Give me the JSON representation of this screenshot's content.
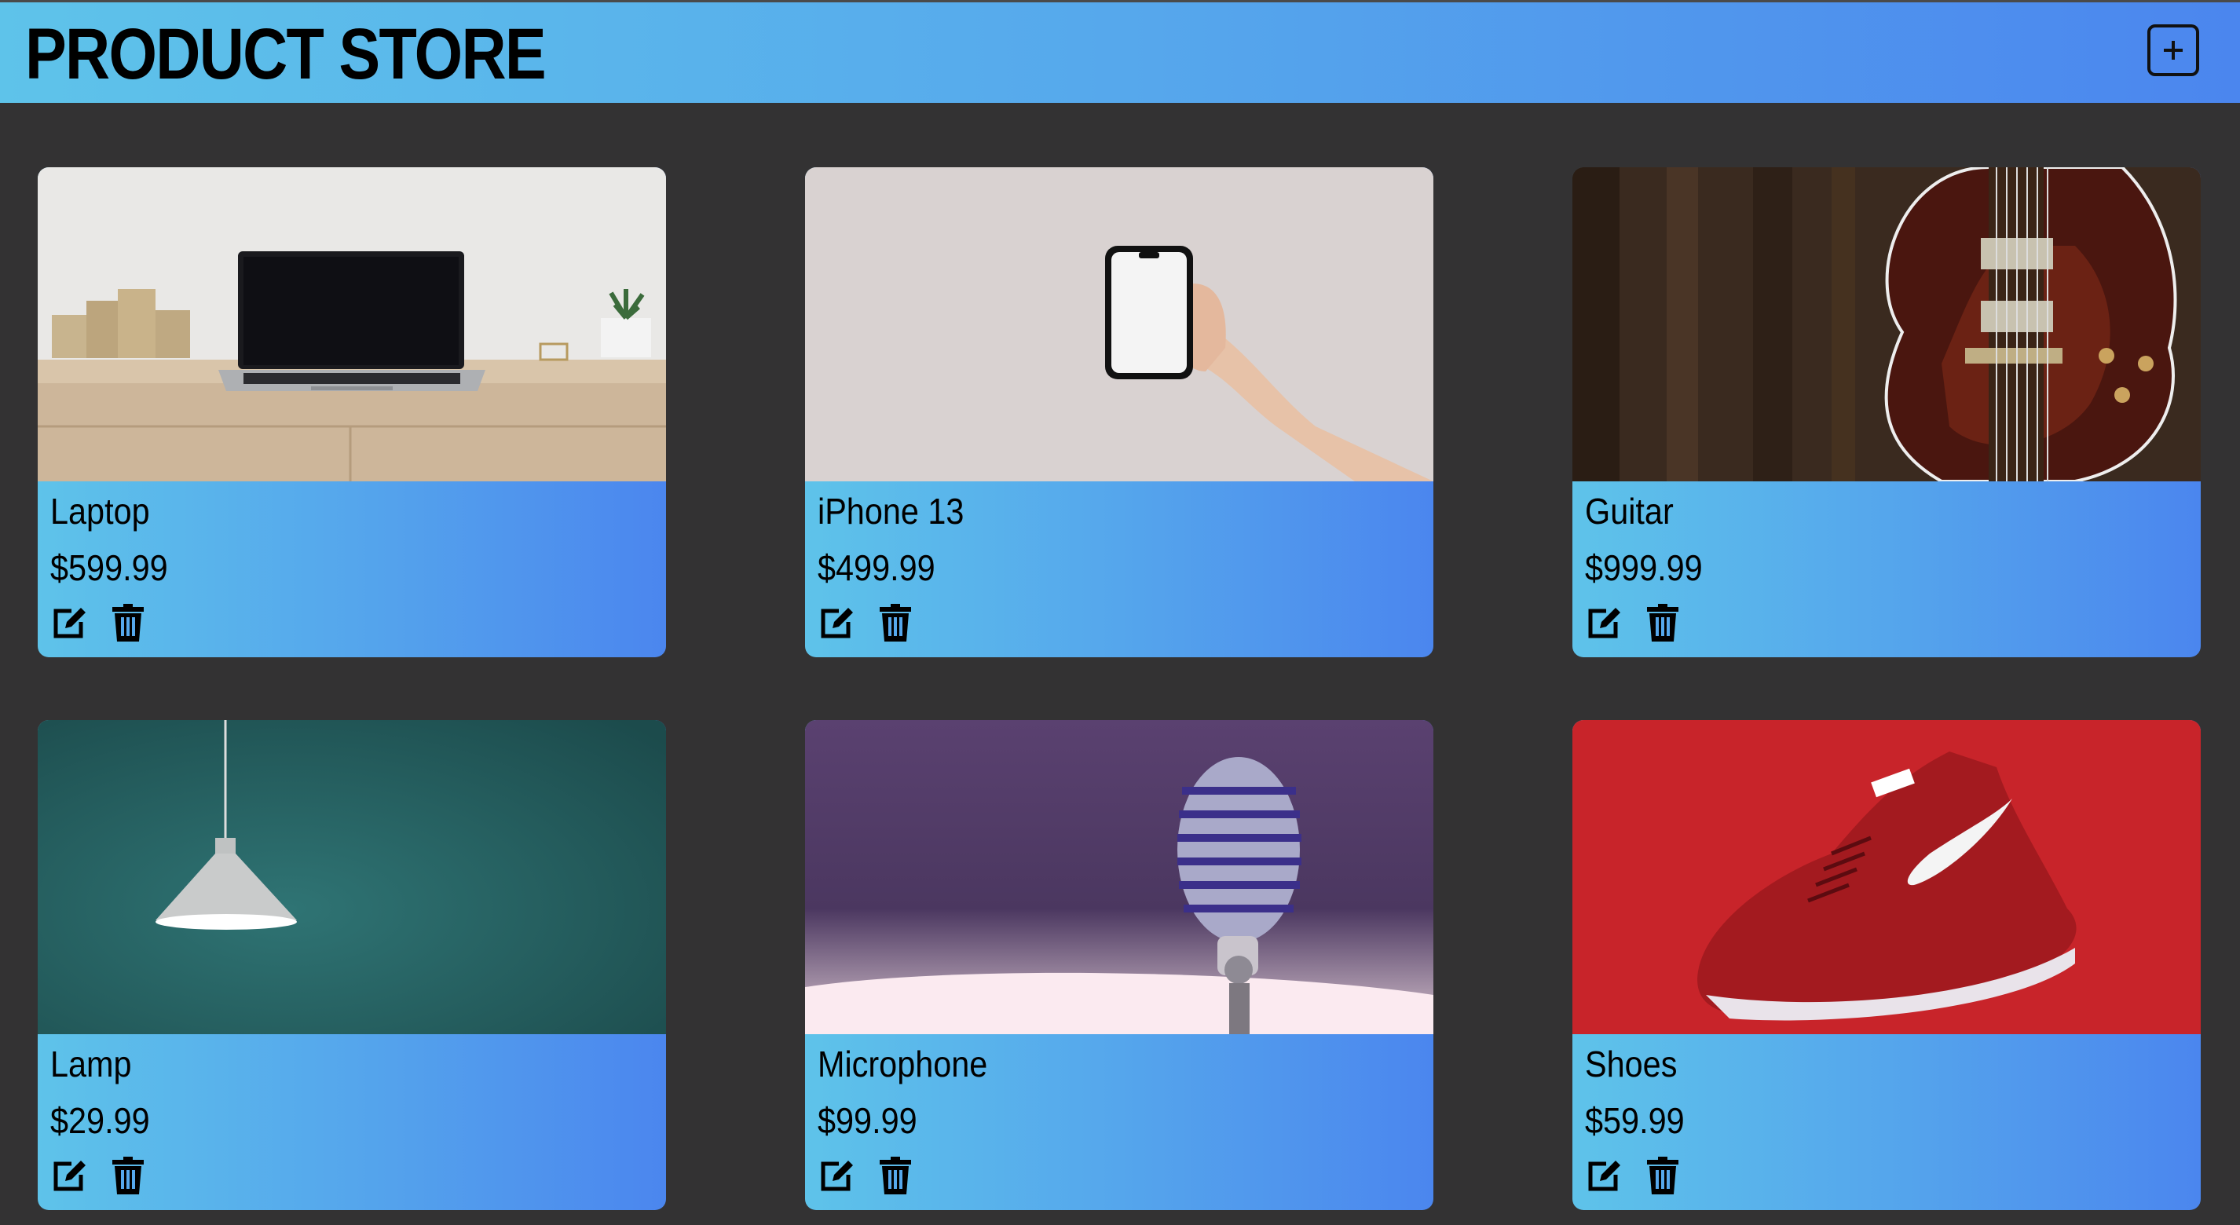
{
  "header": {
    "title": "PRODUCT STORE",
    "add_icon": "plus-square-icon"
  },
  "products": [
    {
      "name": "Laptop",
      "price": "$599.99",
      "image": "laptop-photo"
    },
    {
      "name": "iPhone 13",
      "price": "$499.99",
      "image": "phone-photo"
    },
    {
      "name": "Guitar",
      "price": "$999.99",
      "image": "guitar-photo"
    },
    {
      "name": "Lamp",
      "price": "$29.99",
      "image": "lamp-photo"
    },
    {
      "name": "Microphone",
      "price": "$99.99",
      "image": "microphone-photo"
    },
    {
      "name": "Shoes",
      "price": "$59.99",
      "image": "shoes-photo"
    }
  ],
  "actions": {
    "edit_icon": "edit-icon",
    "delete_icon": "trash-icon"
  },
  "colors": {
    "background": "#333233",
    "header_gradient_start": "#5ec3ea",
    "header_gradient_end": "#4b86ee",
    "text": "#000000"
  }
}
